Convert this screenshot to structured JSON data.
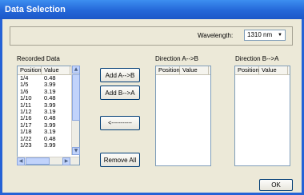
{
  "window": {
    "title": "Data Selection"
  },
  "wavelength": {
    "label": "Wavelength:",
    "value": "1310 nm",
    "arrow_icon": "chevron-down"
  },
  "recorded": {
    "label": "Recorded Data",
    "columns": [
      "Position",
      "Value"
    ],
    "rows": [
      [
        "1/4",
        "0.48"
      ],
      [
        "1/5",
        "3.99"
      ],
      [
        "1/6",
        "3.19"
      ],
      [
        "1/10",
        "0.48"
      ],
      [
        "1/11",
        "3.99"
      ],
      [
        "1/12",
        "3.19"
      ],
      [
        "1/16",
        "0.48"
      ],
      [
        "1/17",
        "3.99"
      ],
      [
        "1/18",
        "3.19"
      ],
      [
        "1/22",
        "0.48"
      ],
      [
        "1/23",
        "3.99"
      ]
    ]
  },
  "dirAB": {
    "label": "Direction A-->B",
    "columns": [
      "Position",
      "Value"
    ]
  },
  "dirBA": {
    "label": "Direction B-->A",
    "columns": [
      "Position",
      "Value"
    ]
  },
  "buttons": {
    "addAB": "Add A-->B",
    "addBA": "Add B-->A",
    "remove": "<-----------",
    "removeAll": "Remove All",
    "ok": "OK"
  }
}
